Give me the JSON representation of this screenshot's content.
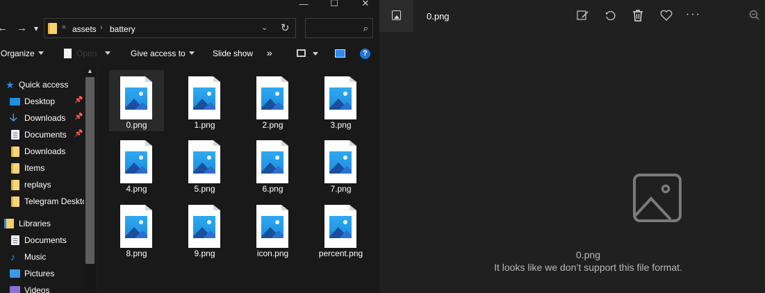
{
  "explorer": {
    "window_buttons": [
      "—",
      "☐",
      "✕"
    ],
    "nav": {
      "back": "←",
      "forward": "→",
      "recent": "▾"
    },
    "address": {
      "overflow": "«",
      "crumbs": [
        "assets",
        "battery"
      ],
      "sep": "›",
      "dropdown": "⌄",
      "refresh": "↻"
    },
    "search": {
      "placeholder": "",
      "icon": "⌕"
    },
    "ribbon": {
      "organize": "Organize",
      "open": "Open",
      "give_access": "Give access to",
      "slideshow": "Slide show",
      "more": "»",
      "help": "?"
    },
    "nav_pane": [
      {
        "label": "Quick access",
        "icon": "star-icon",
        "pinned": false
      },
      {
        "label": "Desktop",
        "icon": "desktop-icon",
        "pinned": true
      },
      {
        "label": "Downloads",
        "icon": "download-icon",
        "pinned": true
      },
      {
        "label": "Documents",
        "icon": "documents-icon",
        "pinned": true
      },
      {
        "label": "Downloads",
        "icon": "folder-icon",
        "pinned": false
      },
      {
        "label": "Items",
        "icon": "folder-icon",
        "pinned": false
      },
      {
        "label": "replays",
        "icon": "folder-icon",
        "pinned": false
      },
      {
        "label": "Telegram Desktop",
        "icon": "folder-icon",
        "pinned": false
      },
      {
        "label": "Libraries",
        "icon": "libraries-icon",
        "pinned": false
      },
      {
        "label": "Documents",
        "icon": "documents-icon",
        "pinned": false
      },
      {
        "label": "Music",
        "icon": "music-icon",
        "pinned": false
      },
      {
        "label": "Pictures",
        "icon": "pictures-icon",
        "pinned": false
      },
      {
        "label": "Videos",
        "icon": "videos-icon",
        "pinned": false
      }
    ],
    "files": [
      "0.png",
      "1.png",
      "2.png",
      "3.png",
      "4.png",
      "5.png",
      "6.png",
      "7.png",
      "8.png",
      "9.png",
      "icon.png",
      "percent.png"
    ],
    "selected_file": "0.png"
  },
  "viewer": {
    "filename": "0.png",
    "tools": [
      "edit-image-icon",
      "rotate-icon",
      "delete-icon",
      "favorite-icon",
      "more-icon",
      "zoom-out-icon"
    ],
    "more": "···",
    "message_name": "0.png",
    "message": "It looks like we don’t support this file format."
  },
  "colors": {
    "explorer_bg": "#191919",
    "viewer_bg": "#202020",
    "accent": "#2b8be8"
  }
}
